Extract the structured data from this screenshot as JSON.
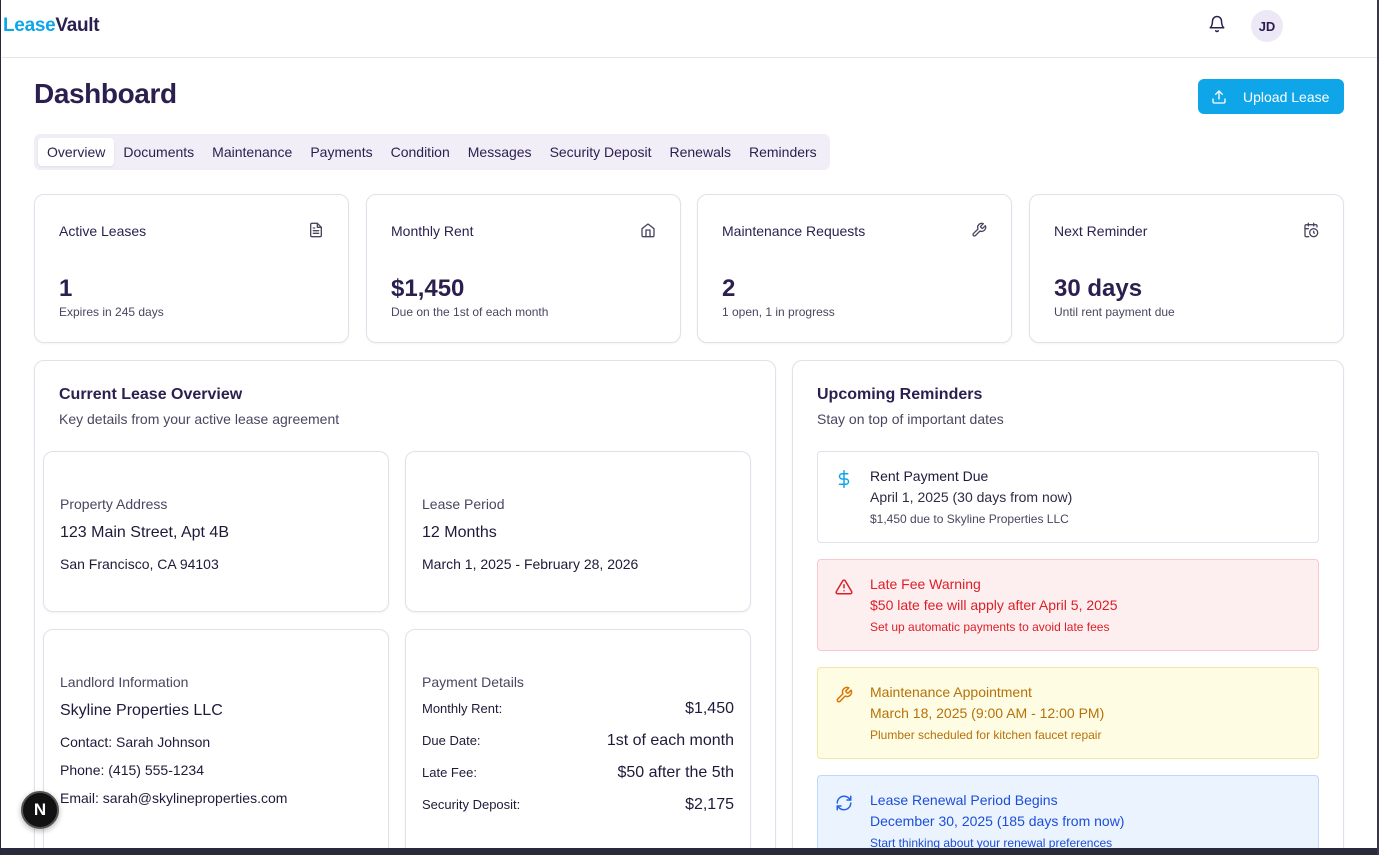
{
  "header": {
    "logo_part1": "Lease",
    "logo_part2": "Vault",
    "avatar_initials": "JD",
    "bell_icon": "bell-icon"
  },
  "page": {
    "title": "Dashboard",
    "upload_button": "Upload Lease"
  },
  "tabs": [
    {
      "label": "Overview",
      "active": true
    },
    {
      "label": "Documents"
    },
    {
      "label": "Maintenance"
    },
    {
      "label": "Payments"
    },
    {
      "label": "Condition"
    },
    {
      "label": "Messages"
    },
    {
      "label": "Security Deposit"
    },
    {
      "label": "Renewals"
    },
    {
      "label": "Reminders"
    }
  ],
  "stats": [
    {
      "label": "Active Leases",
      "value": "1",
      "sub": "Expires in 245 days",
      "icon": "document-icon"
    },
    {
      "label": "Monthly Rent",
      "value": "$1,450",
      "sub": "Due on the 1st of each month",
      "icon": "home-icon"
    },
    {
      "label": "Maintenance Requests",
      "value": "2",
      "sub": "1 open, 1 in progress",
      "icon": "wrench-icon"
    },
    {
      "label": "Next Reminder",
      "value": "30 days",
      "sub": "Until rent payment due",
      "icon": "calendar-clock-icon"
    }
  ],
  "lease_overview": {
    "title": "Current Lease Overview",
    "subtitle": "Key details from your active lease agreement",
    "property": {
      "label": "Property Address",
      "head": "123 Main Street, Apt 4B",
      "text": "San Francisco, CA 94103"
    },
    "period": {
      "label": "Lease Period",
      "head": "12 Months",
      "text": "March 1, 2025 - February 28, 2026"
    },
    "landlord": {
      "label": "Landlord Information",
      "head": "Skyline Properties LLC",
      "contact": "Contact: Sarah Johnson",
      "phone": "Phone: (415) 555-1234",
      "email": "Email: sarah@skylineproperties.com"
    },
    "payment": {
      "label": "Payment Details",
      "rows": [
        {
          "k": "Monthly Rent:",
          "v": "$1,450"
        },
        {
          "k": "Due Date:",
          "v": "1st of each month"
        },
        {
          "k": "Late Fee:",
          "v": "$50 after the 5th"
        },
        {
          "k": "Security Deposit:",
          "v": "$2,175"
        }
      ]
    }
  },
  "reminders": {
    "title": "Upcoming Reminders",
    "subtitle": "Stay on top of important dates",
    "items": [
      {
        "title": "Rent Payment Due",
        "line": "April 1, 2025 (30 days from now)",
        "note": "$1,450 due to Skyline Properties LLC",
        "icon": "dollar-icon",
        "color": "#0ea5e9"
      },
      {
        "title": "Late Fee Warning",
        "line": "$50 late fee will apply after April 5, 2025",
        "note": "Set up automatic payments to avoid late fees",
        "icon": "warning-icon",
        "color": "#dc1f26"
      },
      {
        "title": "Maintenance Appointment",
        "line": "March 18, 2025 (9:00 AM - 12:00 PM)",
        "note": "Plumber scheduled for kitchen faucet repair",
        "icon": "wrench-icon",
        "color": "#d97706"
      },
      {
        "title": "Lease Renewal Period Begins",
        "line": "December 30, 2025 (185 days from now)",
        "note": "Start thinking about your renewal preferences",
        "icon": "refresh-icon",
        "color": "#2563eb"
      }
    ]
  },
  "dev_badge": "N"
}
